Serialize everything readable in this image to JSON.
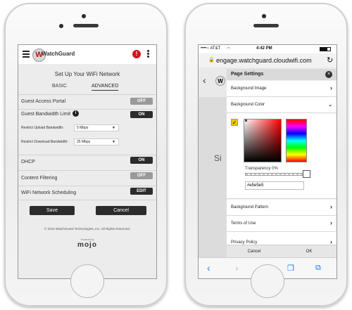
{
  "left_phone": {
    "brand": "WatchGuard",
    "page_title": "Set Up Your WiFi Network",
    "tabs": [
      "BASIC",
      "ADVANCED"
    ],
    "rows": {
      "guest_access_portal": {
        "label": "Guest Access Portal",
        "toggle": "OFF"
      },
      "guest_bandwidth_limit": {
        "label": "Guest Bandwidth Limit",
        "toggle": "ON"
      },
      "upload": {
        "label": "Restrict Upload Bandwidth:",
        "value": "5 Mbps"
      },
      "download": {
        "label": "Restrict Download Bandwidth:",
        "value": "25 Mbps"
      },
      "dhcp": {
        "label": "DHCP",
        "toggle": "ON"
      },
      "content_filtering": {
        "label": "Content Filtering",
        "toggle": "OFF"
      },
      "wifi_scheduling": {
        "label": "WiFi Network Scheduling",
        "button": "EDIT"
      }
    },
    "save": "Save",
    "cancel": "Cancel",
    "footer": "© 2016 WatchGuard Technologies, Inc. All Rights Reserved.",
    "powered_by": "Powered by",
    "mojo": "mojo"
  },
  "right_phone": {
    "status_carrier": "••••○ AT&T",
    "status_time": "4:42 PM",
    "url": "engage.watchguard.cloudwifi.com",
    "bg_text": "Si",
    "panel_title": "Page Settings",
    "items": {
      "background_image": "Background Image",
      "background_color": "Background Color",
      "transparency": "Transparency 0%",
      "hex": "#e5e5e5",
      "background_pattern": "Background Pattern",
      "terms": "Terms of Use",
      "privacy": "Privacy Policy"
    },
    "cancel": "Cancel",
    "ok": "OK"
  },
  "colors": {
    "accent_red": "#d0141b",
    "dark_btn": "#2c2c2c",
    "ios_blue": "#1a7aff"
  }
}
